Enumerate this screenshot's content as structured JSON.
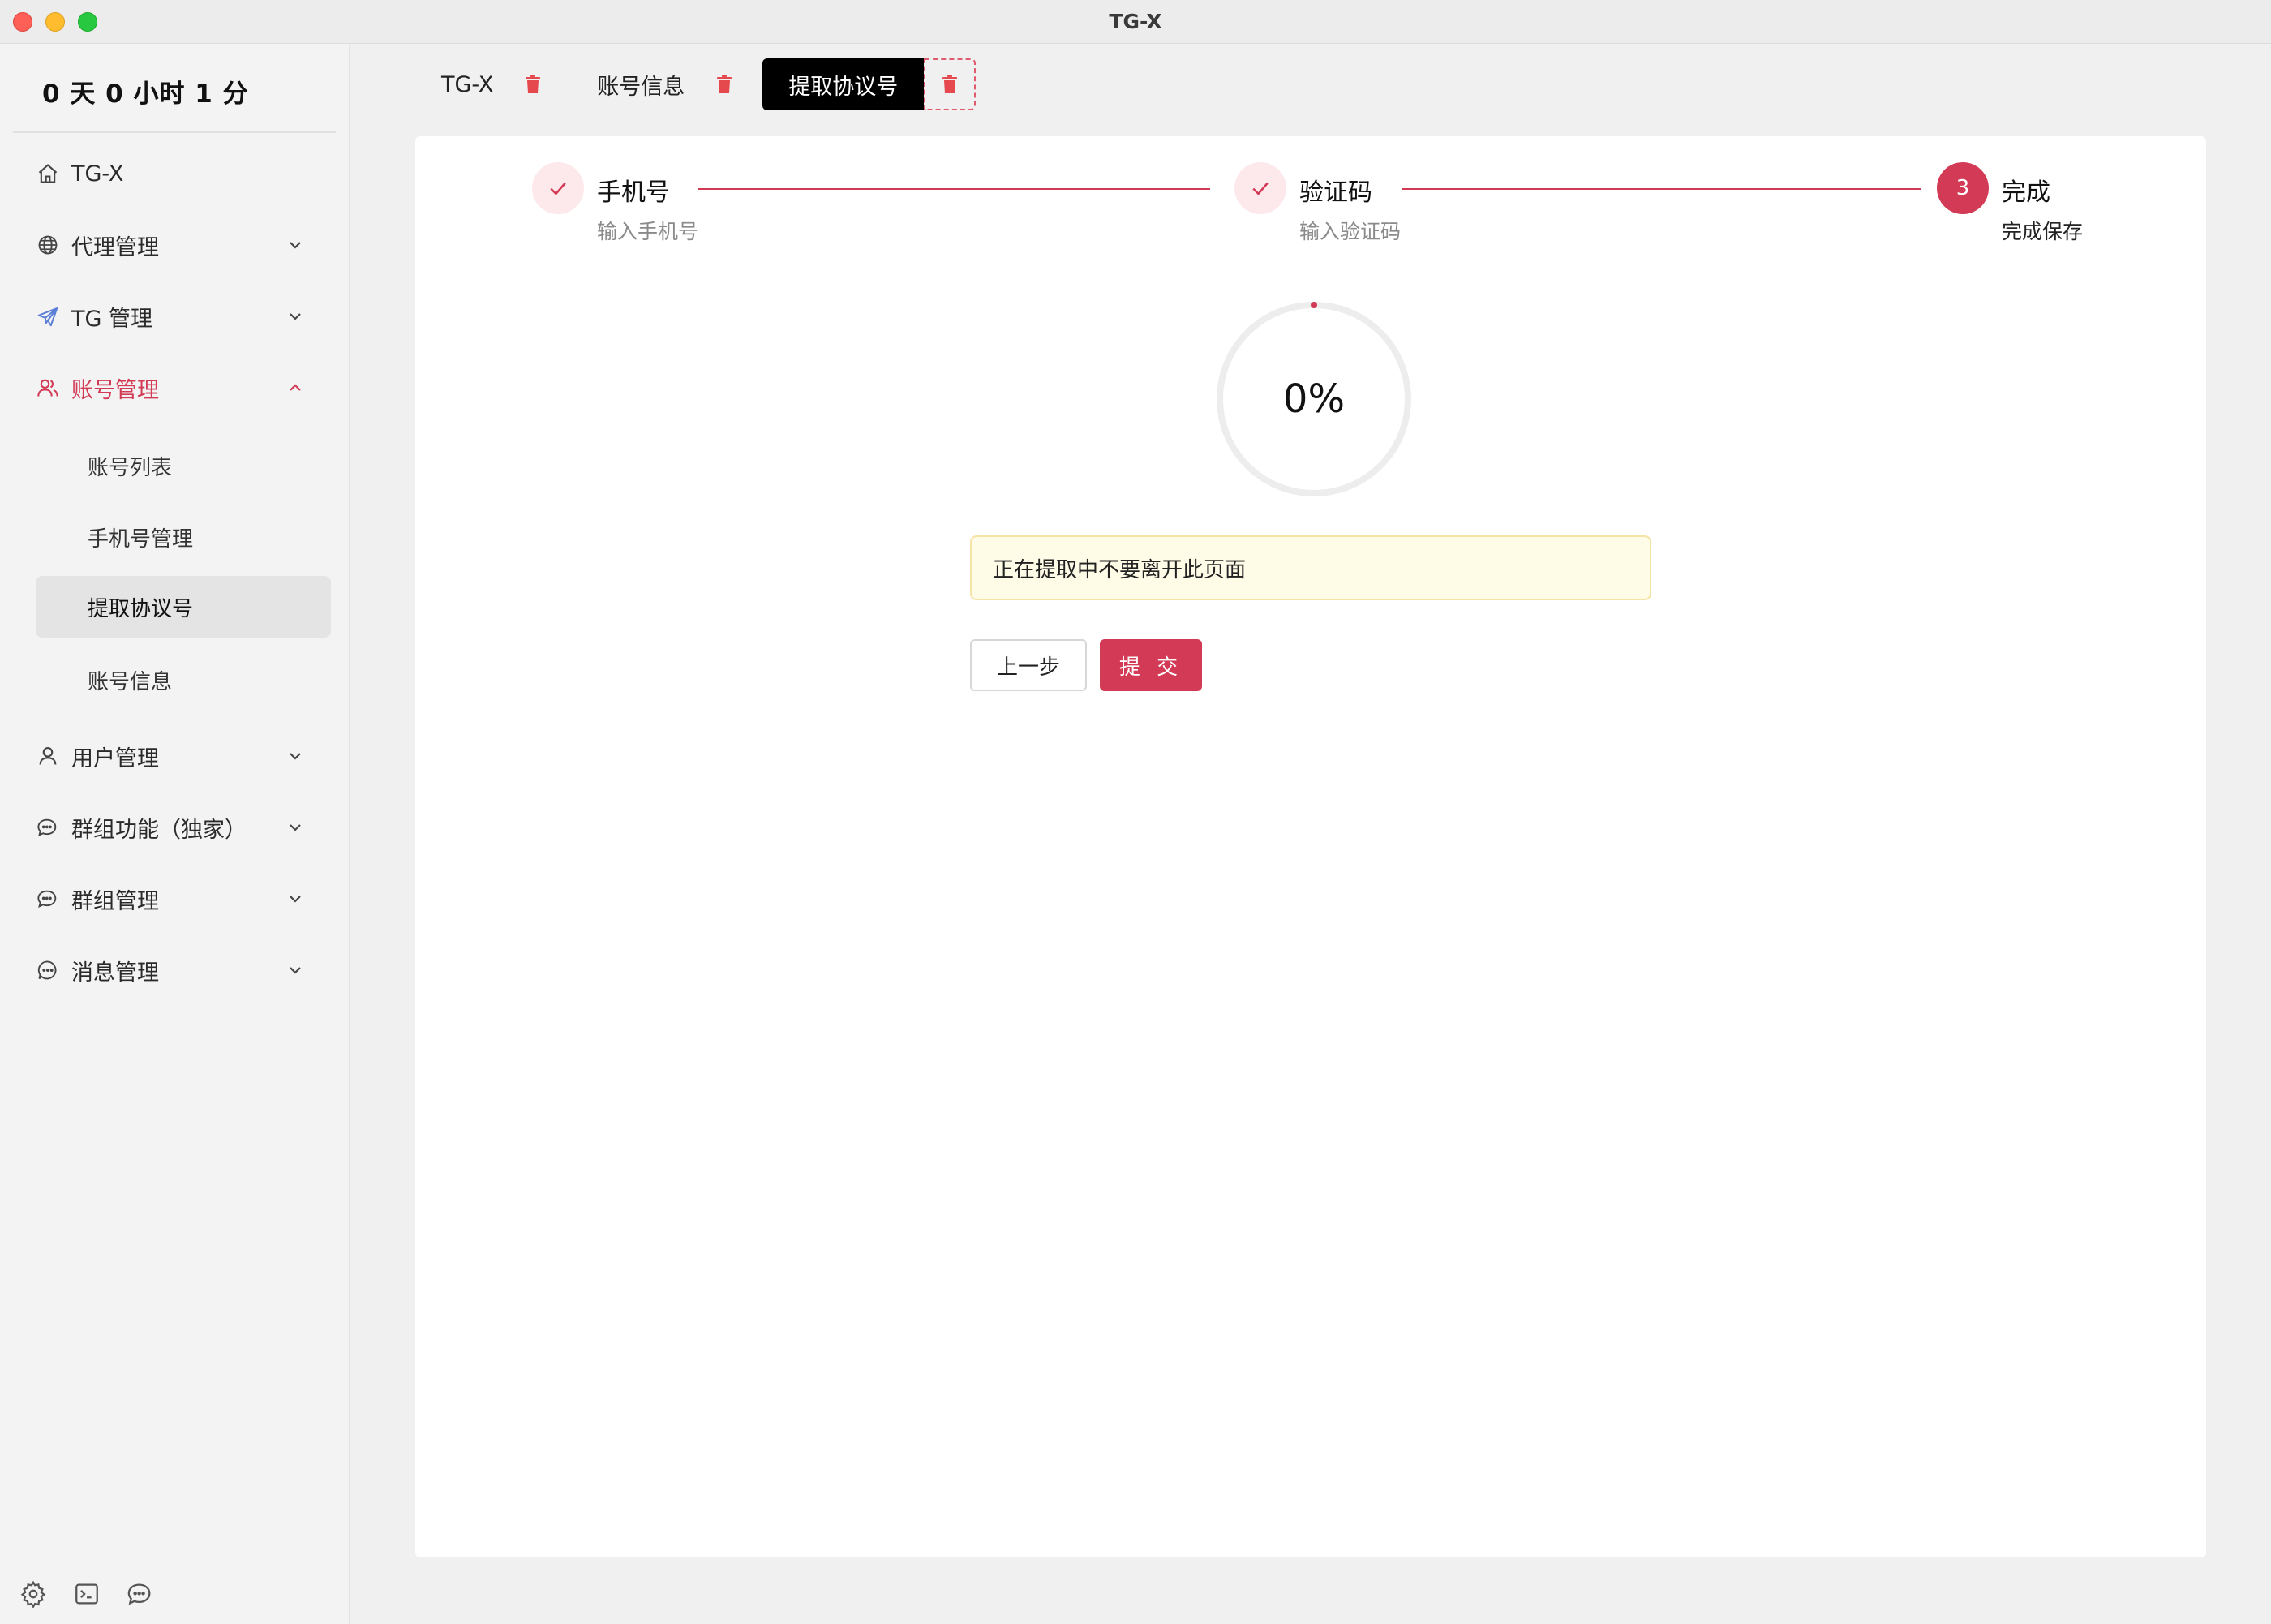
{
  "window": {
    "title": "TG-X"
  },
  "sidebar": {
    "uptime": "0 天 0 小时 1 分",
    "items": [
      {
        "label": "TG-X",
        "icon": "home-icon"
      },
      {
        "label": "代理管理",
        "icon": "globe-icon"
      },
      {
        "label": "TG 管理",
        "icon": "telegram-icon"
      },
      {
        "label": "账号管理",
        "icon": "users-icon"
      },
      {
        "label": "用户管理",
        "icon": "user-icon"
      },
      {
        "label": "群组功能（独家）",
        "icon": "chat-bubbles-icon"
      },
      {
        "label": "群组管理",
        "icon": "chat-bubbles-icon"
      },
      {
        "label": "消息管理",
        "icon": "message-icon"
      }
    ],
    "sub_items": [
      {
        "label": "账号列表"
      },
      {
        "label": "手机号管理"
      },
      {
        "label": "提取协议号"
      },
      {
        "label": "账号信息"
      }
    ],
    "bottom_icons": [
      "gear-icon",
      "terminal-icon",
      "chat-icon"
    ]
  },
  "tabs": [
    {
      "label": "TG-X"
    },
    {
      "label": "账号信息"
    },
    {
      "label": "提取协议号"
    }
  ],
  "steps": [
    {
      "title": "手机号",
      "desc": "输入手机号",
      "status": "done"
    },
    {
      "title": "验证码",
      "desc": "输入验证码",
      "status": "done"
    },
    {
      "title": "完成",
      "desc": "完成保存",
      "status": "current",
      "number": "3"
    }
  ],
  "progress": {
    "value": 0,
    "text": "0%"
  },
  "alert": {
    "text": "正在提取中不要离开此页面"
  },
  "buttons": {
    "prev": "上一步",
    "submit": "提 交"
  },
  "colors": {
    "accent": "#d23a55",
    "delete": "#e5484d",
    "alert_bg": "#fefbe6"
  }
}
